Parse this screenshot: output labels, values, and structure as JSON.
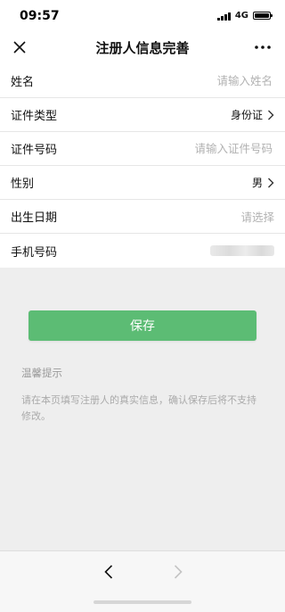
{
  "status_bar": {
    "time": "09:57",
    "network": "4G"
  },
  "nav": {
    "title": "注册人信息完善",
    "close_icon": "close-icon",
    "more_icon": "more-icon"
  },
  "form": {
    "name": {
      "label": "姓名",
      "placeholder": "请输入姓名"
    },
    "id_type": {
      "label": "证件类型",
      "value": "身份证"
    },
    "id_number": {
      "label": "证件号码",
      "placeholder": "请输入证件号码"
    },
    "gender": {
      "label": "性别",
      "value": "男"
    },
    "birth_date": {
      "label": "出生日期",
      "placeholder": "请选择"
    },
    "phone": {
      "label": "手机号码"
    }
  },
  "save_button": {
    "label": "保存",
    "color": "#5cbc74"
  },
  "tips": {
    "title": "温馨提示",
    "text": "请在本页填写注册人的真实信息，确认保存后将不支持修改。"
  },
  "bottom_bar": {
    "back_icon": "back-arrow-icon",
    "forward_icon": "forward-arrow-icon"
  }
}
